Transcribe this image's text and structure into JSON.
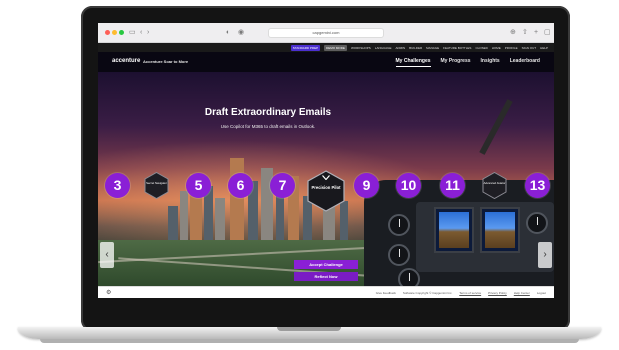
{
  "browser": {
    "url": "capgemini.com"
  },
  "util_bar": {
    "pill_primary": "STANDARD PREP",
    "pill_secondary": "DEMO MODE",
    "items": [
      "WORKSHOPS",
      "LANGUAGE",
      "ADMIN",
      "BUILDER",
      "MANAGE",
      "FEATURE BOTTLES",
      "CLOSED",
      "HOME",
      "PROFILE",
      "SIGN OUT",
      "HELP"
    ]
  },
  "nav": {
    "brand": "accenture",
    "subtitle": "Accenture Soar to More",
    "links": [
      "My Challenges",
      "My Progress",
      "Insights",
      "Leaderboard"
    ]
  },
  "hero": {
    "title": "Draft Extraordinary Emails",
    "subtitle": "Use Copilot for M365 to draft emails in Outlook."
  },
  "challenges": {
    "n3": "3",
    "hex1": "Secret Navigator",
    "n5": "5",
    "n6": "6",
    "n7": "7",
    "precision": "Precision Pilot",
    "n9": "9",
    "n10": "10",
    "n11": "11",
    "hex2": "Advanced Aviator",
    "n13": "13"
  },
  "cta": {
    "accept": "Accept Challenge",
    "reflect": "Reflect Now"
  },
  "footer": {
    "links": [
      "Give Feedback",
      "Software Copyright © Capgemini Inc.",
      "Terms of service",
      "Privacy Policy",
      "Help Center",
      "Logout"
    ]
  },
  "colors": {
    "accent": "#8a1fd6",
    "nav_bg": "#0a0814"
  }
}
